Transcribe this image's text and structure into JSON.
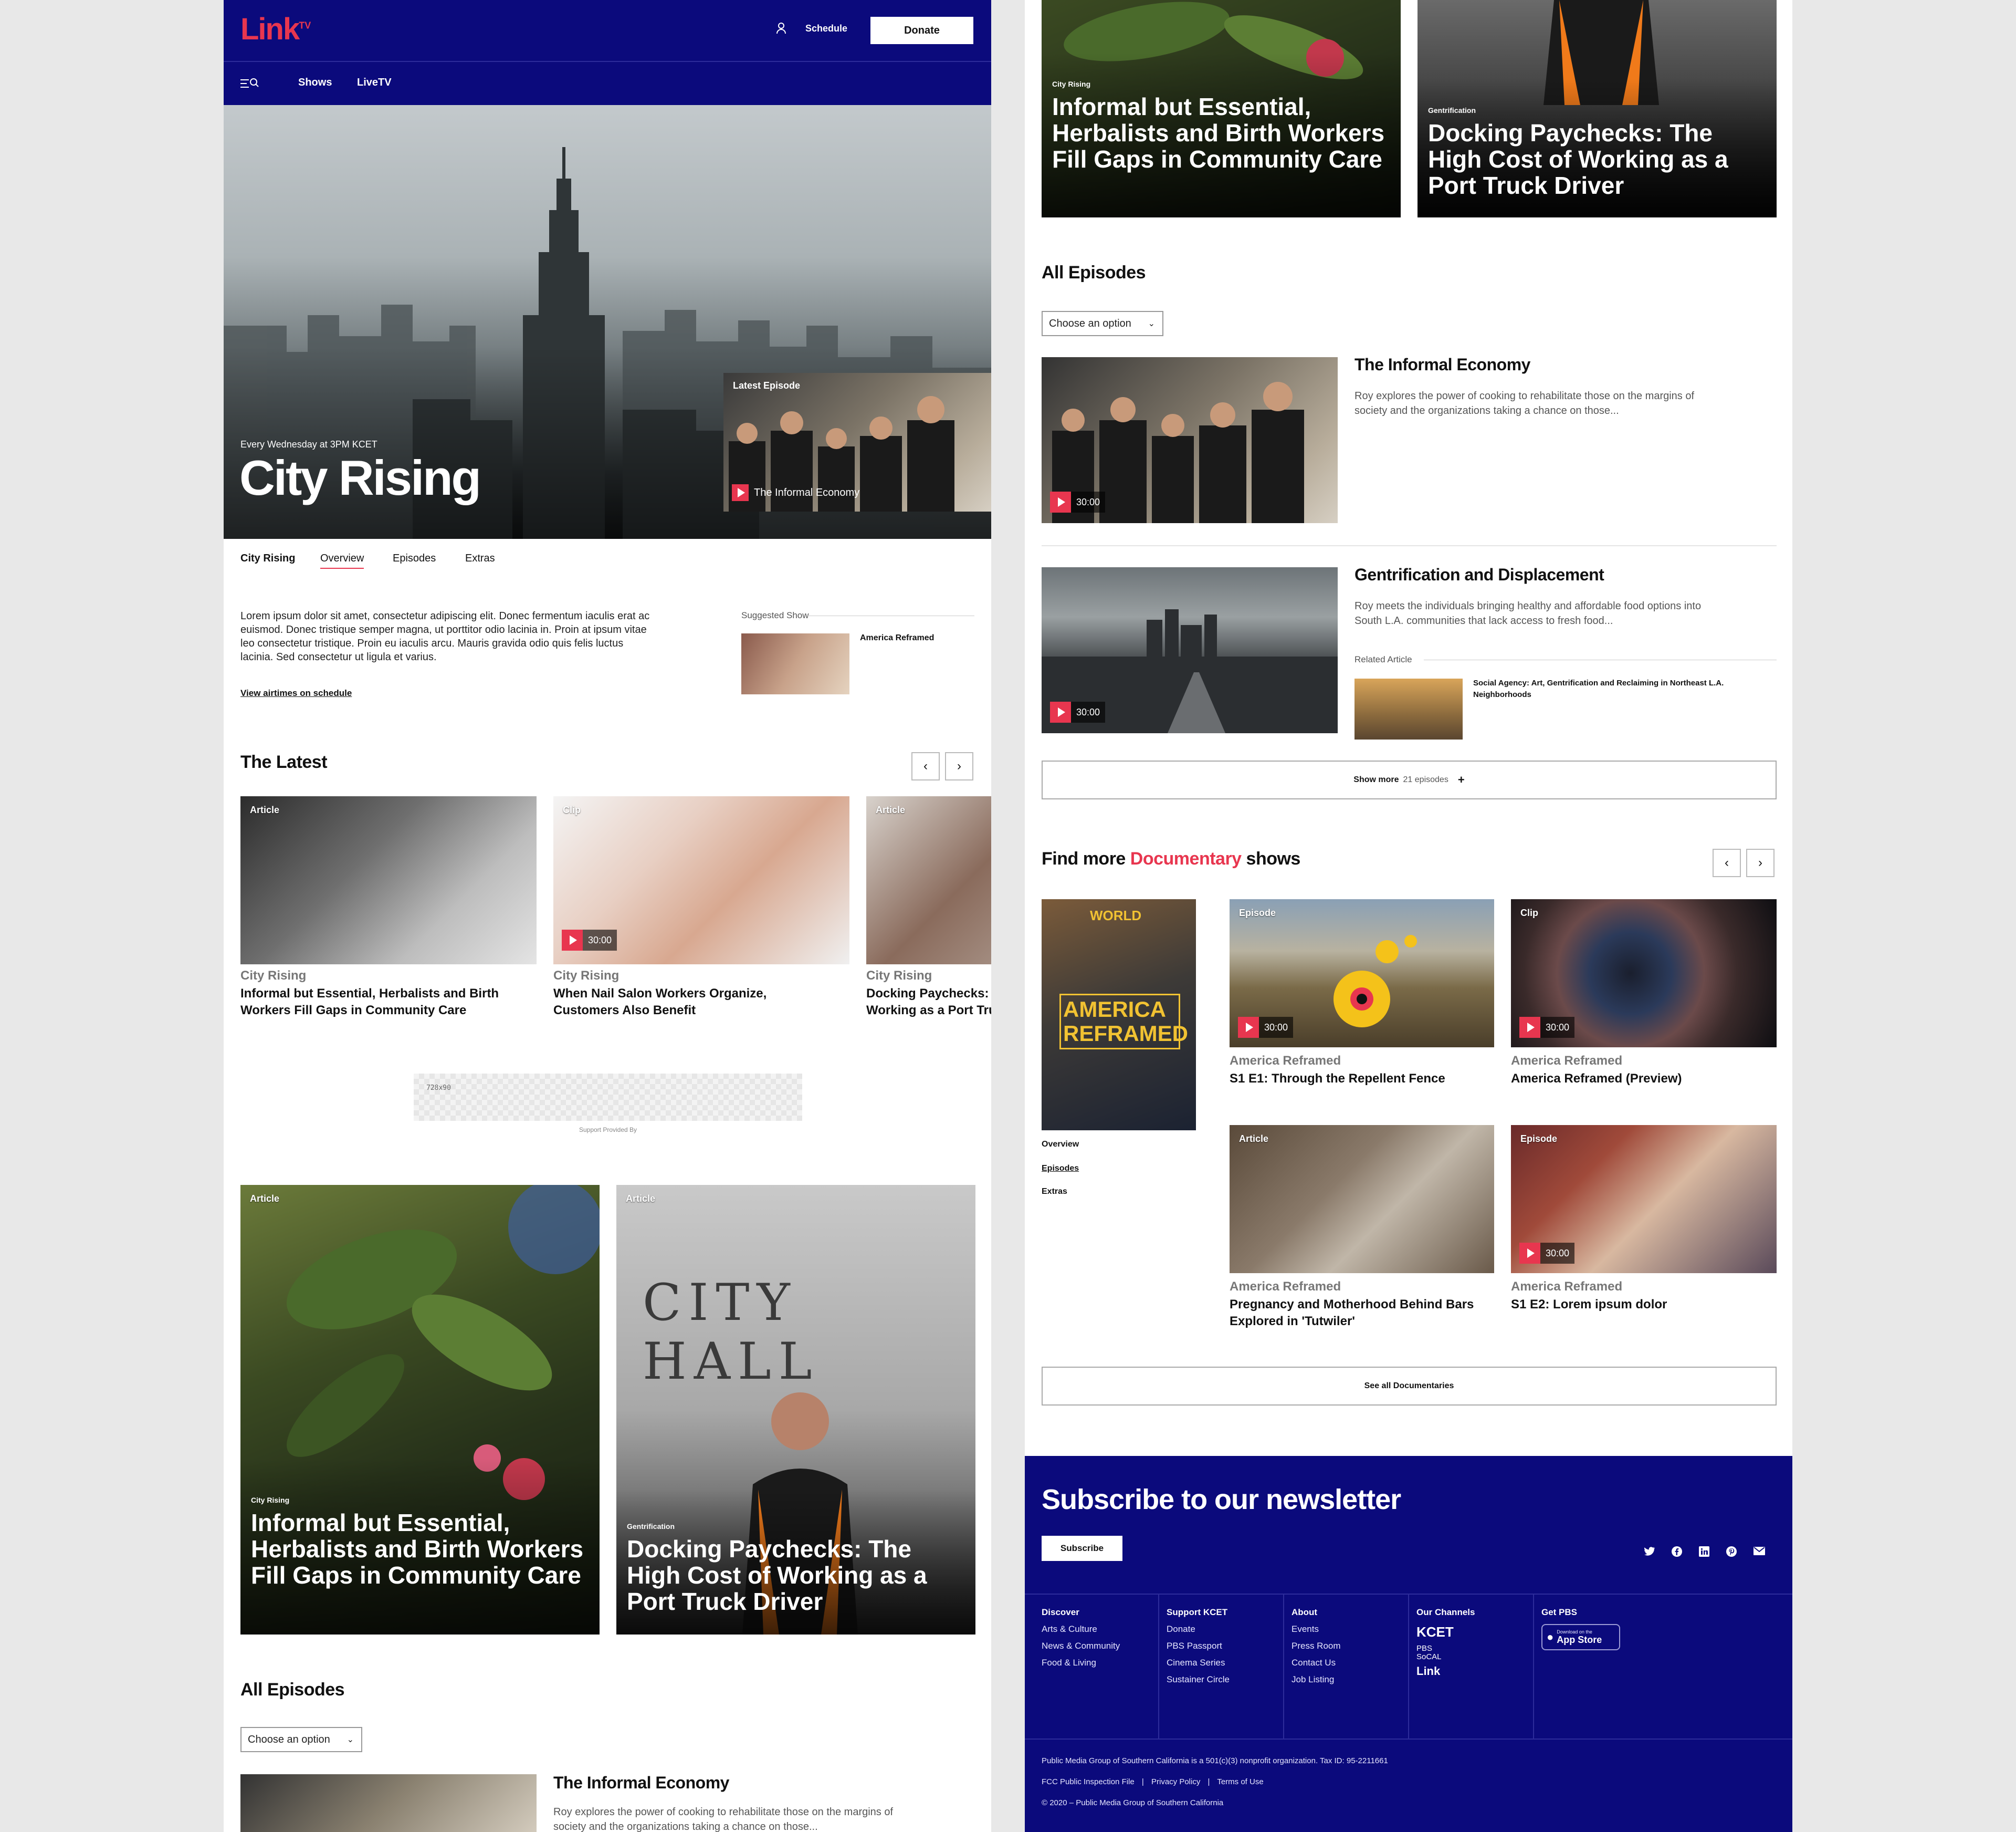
{
  "header": {
    "logo": "Link",
    "logo_sup": "TV",
    "schedule": "Schedule",
    "donate": "Donate",
    "nav": [
      "Shows",
      "LiveTV"
    ]
  },
  "hero": {
    "airtime": "Every Wednesday at 3PM KCET",
    "title": "City Rising",
    "latest_label": "Latest Episode",
    "latest_title": "The Informal Economy"
  },
  "tabs": {
    "show": "City Rising",
    "items": [
      "Overview",
      "Episodes",
      "Extras"
    ]
  },
  "overview": {
    "body": "Lorem ipsum dolor sit amet, consectetur adipiscing elit. Donec fermentum iaculis erat ac euismod. Donec tristique semper magna, ut porttitor odio lacinia in. Proin at ipsum vitae leo consectetur tristique. Proin eu iaculis arcu. Mauris gravida odio quis felis luctus lacinia. Sed consectetur ut ligula et varius.",
    "link": "View airtimes on schedule",
    "suggested_label": "Suggested Show",
    "suggested_title": "America Reframed"
  },
  "latest": {
    "heading": "The Latest",
    "cards": [
      {
        "tag": "Article",
        "series": "City Rising",
        "title": "Informal but Essential, Herbalists and Birth Workers Fill Gaps in Community Care"
      },
      {
        "tag": "Clip",
        "duration": "30:00",
        "series": "City Rising",
        "title": "When Nail Salon Workers Organize, Customers Also Benefit"
      },
      {
        "tag": "Article",
        "series": "City Rising",
        "title": "Docking Paychecks: The High Cost of Working as a Port Truck Driver"
      }
    ]
  },
  "ad": {
    "size": "728x90",
    "label": "Support Provided By"
  },
  "features": [
    {
      "tag": "Article",
      "sub": "City Rising",
      "title": "Informal but Essential, Herbalists and Birth Workers Fill Gaps in Community Care"
    },
    {
      "tag": "Article",
      "sub": "Gentrification",
      "title": "Docking Paychecks: The High Cost of Working as a Port Truck Driver"
    }
  ],
  "all_episodes": {
    "heading": "All Episodes",
    "select": "Choose an option",
    "episodes": [
      {
        "duration": "30:00",
        "title": "The Informal Economy",
        "desc": "Roy explores the power of cooking to rehabilitate those on the margins of society and the organizations taking a chance on those..."
      },
      {
        "duration": "30:00",
        "title": "Gentrification and Displacement",
        "desc": "Roy meets the individuals bringing healthy and affordable food options into South L.A. communities that lack access to fresh food...",
        "related_label": "Related Article",
        "related_title": "Social Agency: Art, Gentrification and Reclaiming in Northeast L.A. Neighborhoods"
      }
    ],
    "show_more": "Show more",
    "show_more_count": "21 episodes",
    "show_more_plus": "+"
  },
  "find_more": {
    "prefix": "Find more",
    "accent": "Documentary",
    "suffix": "shows",
    "poster_top": "WORLD",
    "poster_title": "AMERICA REFRAMED",
    "side_links": [
      "Overview",
      "Episodes",
      "Extras"
    ],
    "cards": [
      {
        "tag": "Episode",
        "duration": "30:00",
        "series": "America Reframed",
        "title": "S1 E1: Through the Repellent Fence"
      },
      {
        "tag": "Clip",
        "duration": "30:00",
        "series": "America Reframed",
        "title": "America Reframed (Preview)"
      },
      {
        "tag": "Article",
        "series": "America Reframed",
        "title": "Pregnancy and Motherhood Behind Bars Explored in 'Tutwiler'"
      },
      {
        "tag": "Episode",
        "duration": "30:00",
        "series": "America Reframed",
        "title": "S1 E2: Lorem ipsum dolor"
      }
    ],
    "see_all": "See all Documentaries"
  },
  "footer": {
    "heading": "Subscribe to our newsletter",
    "subscribe": "Subscribe",
    "social_icons": [
      "twitter-icon",
      "facebook-icon",
      "linkedin-icon",
      "pinterest-icon",
      "mail-icon"
    ],
    "columns": [
      {
        "title": "Discover",
        "links": [
          "Arts & Culture",
          "News & Community",
          "Food & Living"
        ]
      },
      {
        "title": "Support KCET",
        "links": [
          "Donate",
          "PBS Passport",
          "Cinema Series",
          "Sustainer Circle"
        ]
      },
      {
        "title": "About",
        "links": [
          "Events",
          "Press Room",
          "Contact Us",
          "Job Listing"
        ]
      },
      {
        "title": "Our Channels",
        "links": [
          "KCET",
          "PBS SoCAL",
          "Link"
        ]
      },
      {
        "title": "Get PBS",
        "links": [
          "Download on the",
          "App Store"
        ]
      }
    ],
    "legal1": "Public Media Group of Southern California is a 501(c)(3) nonprofit organization. Tax ID: 95-2211661",
    "legal_links": [
      "FCC Public Inspection File",
      "Privacy Policy",
      "Terms of Use"
    ],
    "copyright": "© 2020 – Public Media Group of Southern California"
  },
  "colors": {
    "navy": "#0b0a7c",
    "accent": "#e8364f"
  }
}
